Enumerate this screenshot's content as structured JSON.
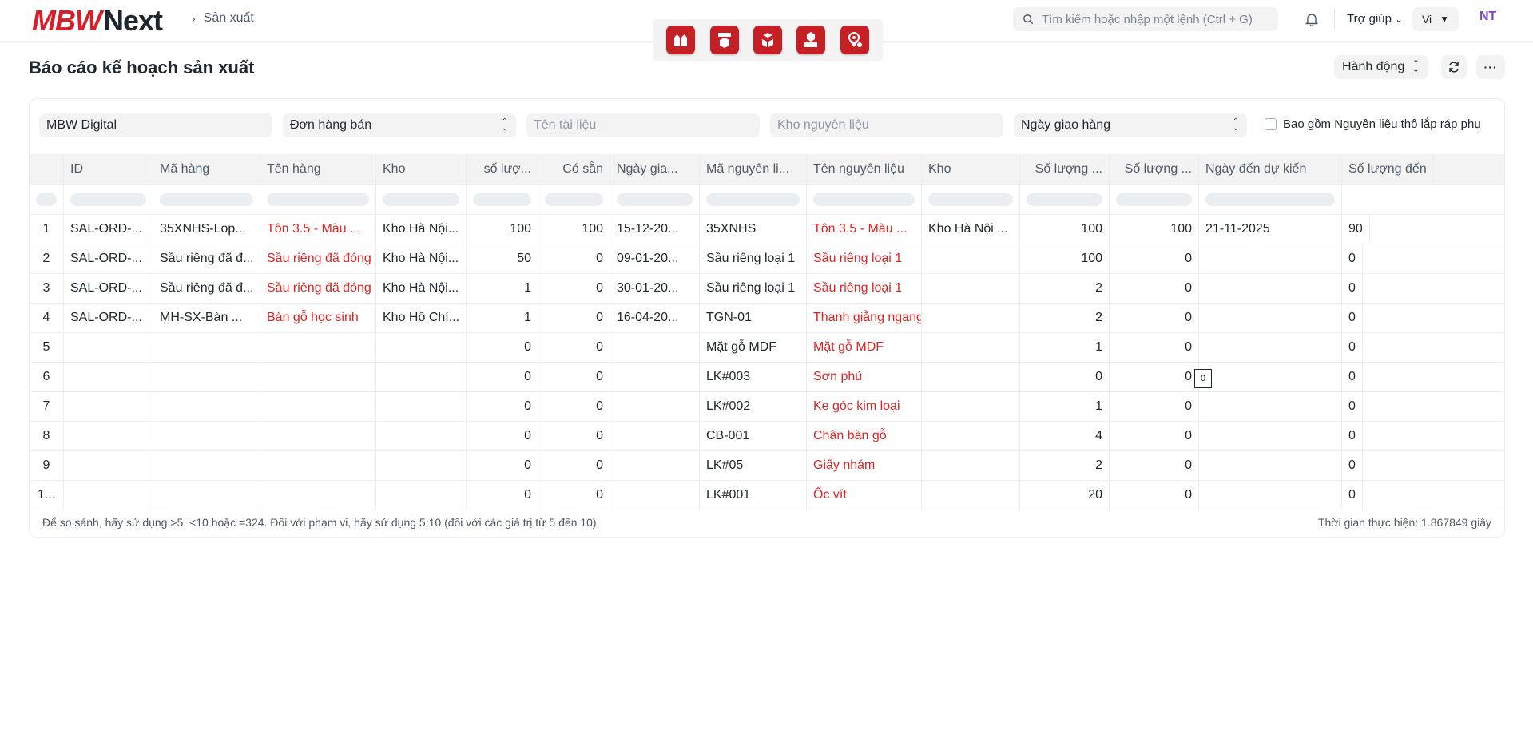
{
  "navbar": {
    "logo_part1": "MBW",
    "logo_part2": "Next",
    "breadcrumb": "Sản xuất",
    "search_placeholder": "Tìm kiếm hoặc nhập một lệnh (Ctrl + G)",
    "help_label": "Trợ giúp",
    "lang_label": "Vi",
    "avatar_initials": "NT",
    "apps": [
      "factory-icon",
      "production-plan-icon",
      "warehouse-icon",
      "machine-icon",
      "location-icon"
    ]
  },
  "page": {
    "title": "Báo cáo kế hoạch sản xuất",
    "action_label": "Hành động"
  },
  "filters": {
    "company": "MBW Digital",
    "doc_type": "Đơn hàng bán",
    "doc_name_placeholder": "Tên tài liệu",
    "warehouse_placeholder": "Kho nguyên liệu",
    "date_type": "Ngày giao hàng",
    "include_label": "Bao gồm Nguyên liệu thô lắp ráp phụ"
  },
  "table": {
    "columns": [
      "ID",
      "Mã hàng",
      "Tên hàng",
      "Kho",
      "số lượ...",
      "Có sẵn",
      "Ngày gia...",
      "Mã nguyên li...",
      "Tên nguyên liệu",
      "Kho",
      "Số lượng ...",
      "Số lượng ...",
      "Ngày đến dự kiến",
      "Số lượng đến"
    ],
    "rows": [
      {
        "idx": "1",
        "c": [
          "SAL-ORD-...",
          "35XNHS-Lop...",
          "Tôn 3.5 - Màu ...",
          "Kho Hà Nội...",
          "100",
          "100",
          "15-12-20...",
          "35XNHS",
          "Tôn 3.5 - Màu ...",
          "Kho Hà Nội ...",
          "100",
          "100",
          "21-11-2025",
          "90"
        ]
      },
      {
        "idx": "2",
        "c": [
          "SAL-ORD-...",
          "Sầu riêng đã đ...",
          "Sầu riêng đã đóng",
          "Kho Hà Nội...",
          "50",
          "0",
          "09-01-20...",
          "Sầu riêng loại 1",
          "Sầu riêng loại 1",
          "",
          "100",
          "0",
          "",
          "0"
        ]
      },
      {
        "idx": "3",
        "c": [
          "SAL-ORD-...",
          "Sầu riêng đã đ...",
          "Sầu riêng đã đóng",
          "Kho Hà Nội...",
          "1",
          "0",
          "30-01-20...",
          "Sầu riêng loại 1",
          "Sầu riêng loại 1",
          "",
          "2",
          "0",
          "",
          "0"
        ]
      },
      {
        "idx": "4",
        "c": [
          "SAL-ORD-...",
          "MH-SX-Bàn ...",
          "Bàn gỗ học sinh",
          "Kho Hồ Chí...",
          "1",
          "0",
          "16-04-20...",
          "TGN-01",
          "Thanh giằng ngang",
          "",
          "2",
          "0",
          "",
          "0"
        ]
      },
      {
        "idx": "5",
        "c": [
          "",
          "",
          "",
          "",
          "0",
          "0",
          "",
          "Mặt gỗ MDF",
          "Mặt gỗ MDF",
          "",
          "1",
          "0",
          "",
          "0"
        ]
      },
      {
        "idx": "6",
        "c": [
          "",
          "",
          "",
          "",
          "0",
          "0",
          "",
          "LK#003",
          "Sơn phủ",
          "",
          "0",
          "0",
          "",
          "0"
        ]
      },
      {
        "idx": "7",
        "c": [
          "",
          "",
          "",
          "",
          "0",
          "0",
          "",
          "LK#002",
          "Ke góc kim loại",
          "",
          "1",
          "0",
          "",
          "0"
        ]
      },
      {
        "idx": "8",
        "c": [
          "",
          "",
          "",
          "",
          "0",
          "0",
          "",
          "CB-001",
          "Chân bàn gỗ",
          "",
          "4",
          "0",
          "",
          "0"
        ]
      },
      {
        "idx": "9",
        "c": [
          "",
          "",
          "",
          "",
          "0",
          "0",
          "",
          "LK#05",
          "Giấy nhám",
          "",
          "2",
          "0",
          "",
          "0"
        ]
      },
      {
        "idx": "1...",
        "c": [
          "",
          "",
          "",
          "",
          "0",
          "0",
          "",
          "LK#001",
          "Ốc vít",
          "",
          "20",
          "0",
          "",
          "0"
        ]
      }
    ],
    "cell_tooltip": "0"
  },
  "footer": {
    "hint": "Để so sánh, hãy sử dụng >5, <10 hoặc =324. Đối với phạm vi, hãy sử dụng 5:10 (đối với các giá trị từ 5 đến 10).",
    "timing": "Thời gian thực hiện: 1.867849 giây"
  },
  "colors": {
    "brand": "#d4202a",
    "link_red": "#e02424",
    "avatar": "#7b48cc"
  }
}
